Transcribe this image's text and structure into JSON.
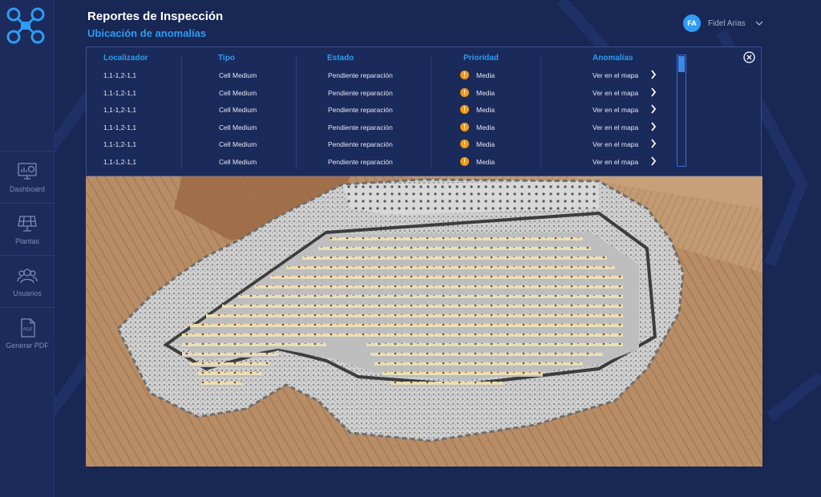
{
  "header": {
    "title": "Reportes de Inspección",
    "subtitle": "Ubicación de anomalías"
  },
  "user": {
    "initials": "FA",
    "name": "Fidel Arias"
  },
  "sidebar": {
    "items": [
      {
        "label": "Dashboard",
        "icon": "dashboard-monitor-icon"
      },
      {
        "label": "Plantas",
        "icon": "solar-panel-icon"
      },
      {
        "label": "Usuarios",
        "icon": "users-icon"
      },
      {
        "label": "Generar PDF",
        "icon": "pdf-file-icon"
      }
    ]
  },
  "table": {
    "columns": [
      "Localizador",
      "Tipo",
      "Estado",
      "Prioridad",
      "Anomalías"
    ],
    "rows": [
      {
        "localizador": "1,1-1,2-1,1",
        "tipo": "Cell Medium",
        "estado": "Pendiente reparación",
        "prioridad": "Media",
        "anomalias": "Ver en el mapa"
      },
      {
        "localizador": "1,1-1,2-1,1",
        "tipo": "Cell Medium",
        "estado": "Pendiente reparación",
        "prioridad": "Media",
        "anomalias": "Ver en el mapa"
      },
      {
        "localizador": "1,1-1,2-1,1",
        "tipo": "Cell Medium",
        "estado": "Pendiente reparación",
        "prioridad": "Media",
        "anomalias": "Ver en el mapa"
      },
      {
        "localizador": "1,1-1,2-1,1",
        "tipo": "Cell Medium",
        "estado": "Pendiente reparación",
        "prioridad": "Media",
        "anomalias": "Ver en el mapa"
      },
      {
        "localizador": "1,1-1,2-1,1",
        "tipo": "Cell Medium",
        "estado": "Pendiente reparación",
        "prioridad": "Media",
        "anomalias": "Ver en el mapa"
      },
      {
        "localizador": "1,1-1,2-1,1",
        "tipo": "Cell Medium",
        "estado": "Pendiente reparación",
        "prioridad": "Media",
        "anomalias": "Ver en el mapa"
      }
    ]
  },
  "colors": {
    "background": "#182754",
    "accent": "#2c9cf2",
    "priority_medium": "#f39a12",
    "panel_border": "#3b4f8e"
  },
  "icons": {
    "logo": "drone-logo-icon",
    "close": "close-circle-icon",
    "chevron": "chevron-down-icon",
    "row_arrow": "chevron-right-icon",
    "priority": "warning-circle-icon"
  }
}
